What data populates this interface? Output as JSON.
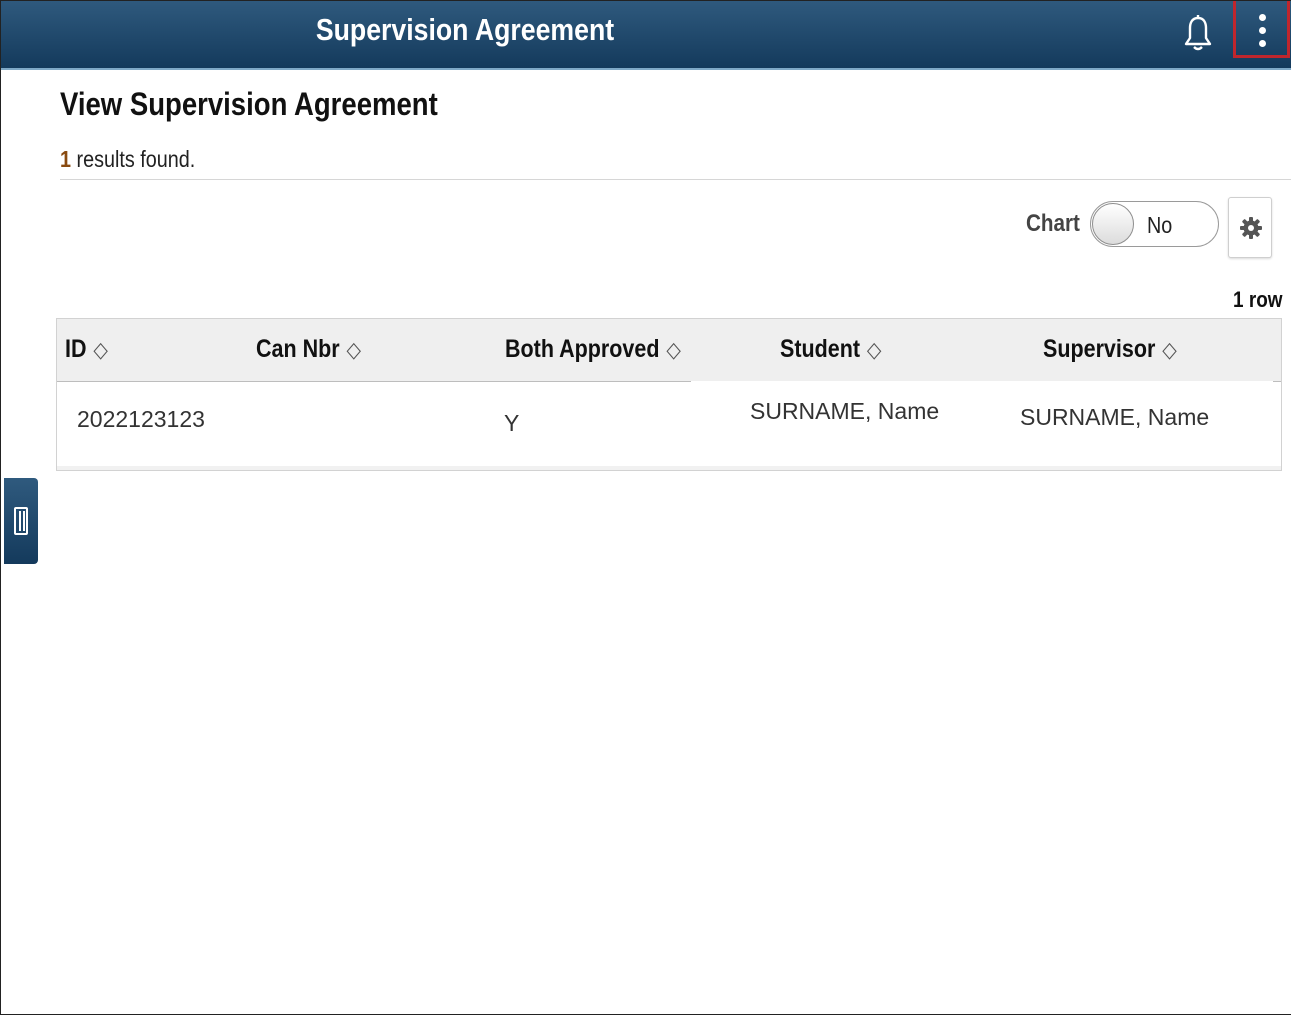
{
  "header": {
    "title": "Supervision Agreement",
    "icons": {
      "notifications": "bell-icon",
      "actions": "vertical-dots-icon"
    }
  },
  "page": {
    "title": "View Supervision Agreement",
    "results_count": "1",
    "results_suffix": " results found."
  },
  "chart_toggle": {
    "label": "Chart",
    "value": "No"
  },
  "settings": {
    "icon": "gear-icon"
  },
  "grid": {
    "row_count_label": "1 row",
    "columns": [
      "ID",
      "Can Nbr",
      "Both Approved",
      "Student",
      "Supervisor"
    ],
    "sort_glyph": "◇",
    "rows": [
      {
        "id": "2022123123",
        "can_nbr": "",
        "both_approved": "Y",
        "student": "SURNAME, Name",
        "supervisor": "SURNAME, Name"
      }
    ]
  },
  "side_panel": {
    "icon": "panel-collapse-icon"
  },
  "colors": {
    "banner_top": "#2f5a7e",
    "banner_bottom": "#143a5c",
    "highlight": "#c0262d",
    "count": "#8a4b10"
  }
}
